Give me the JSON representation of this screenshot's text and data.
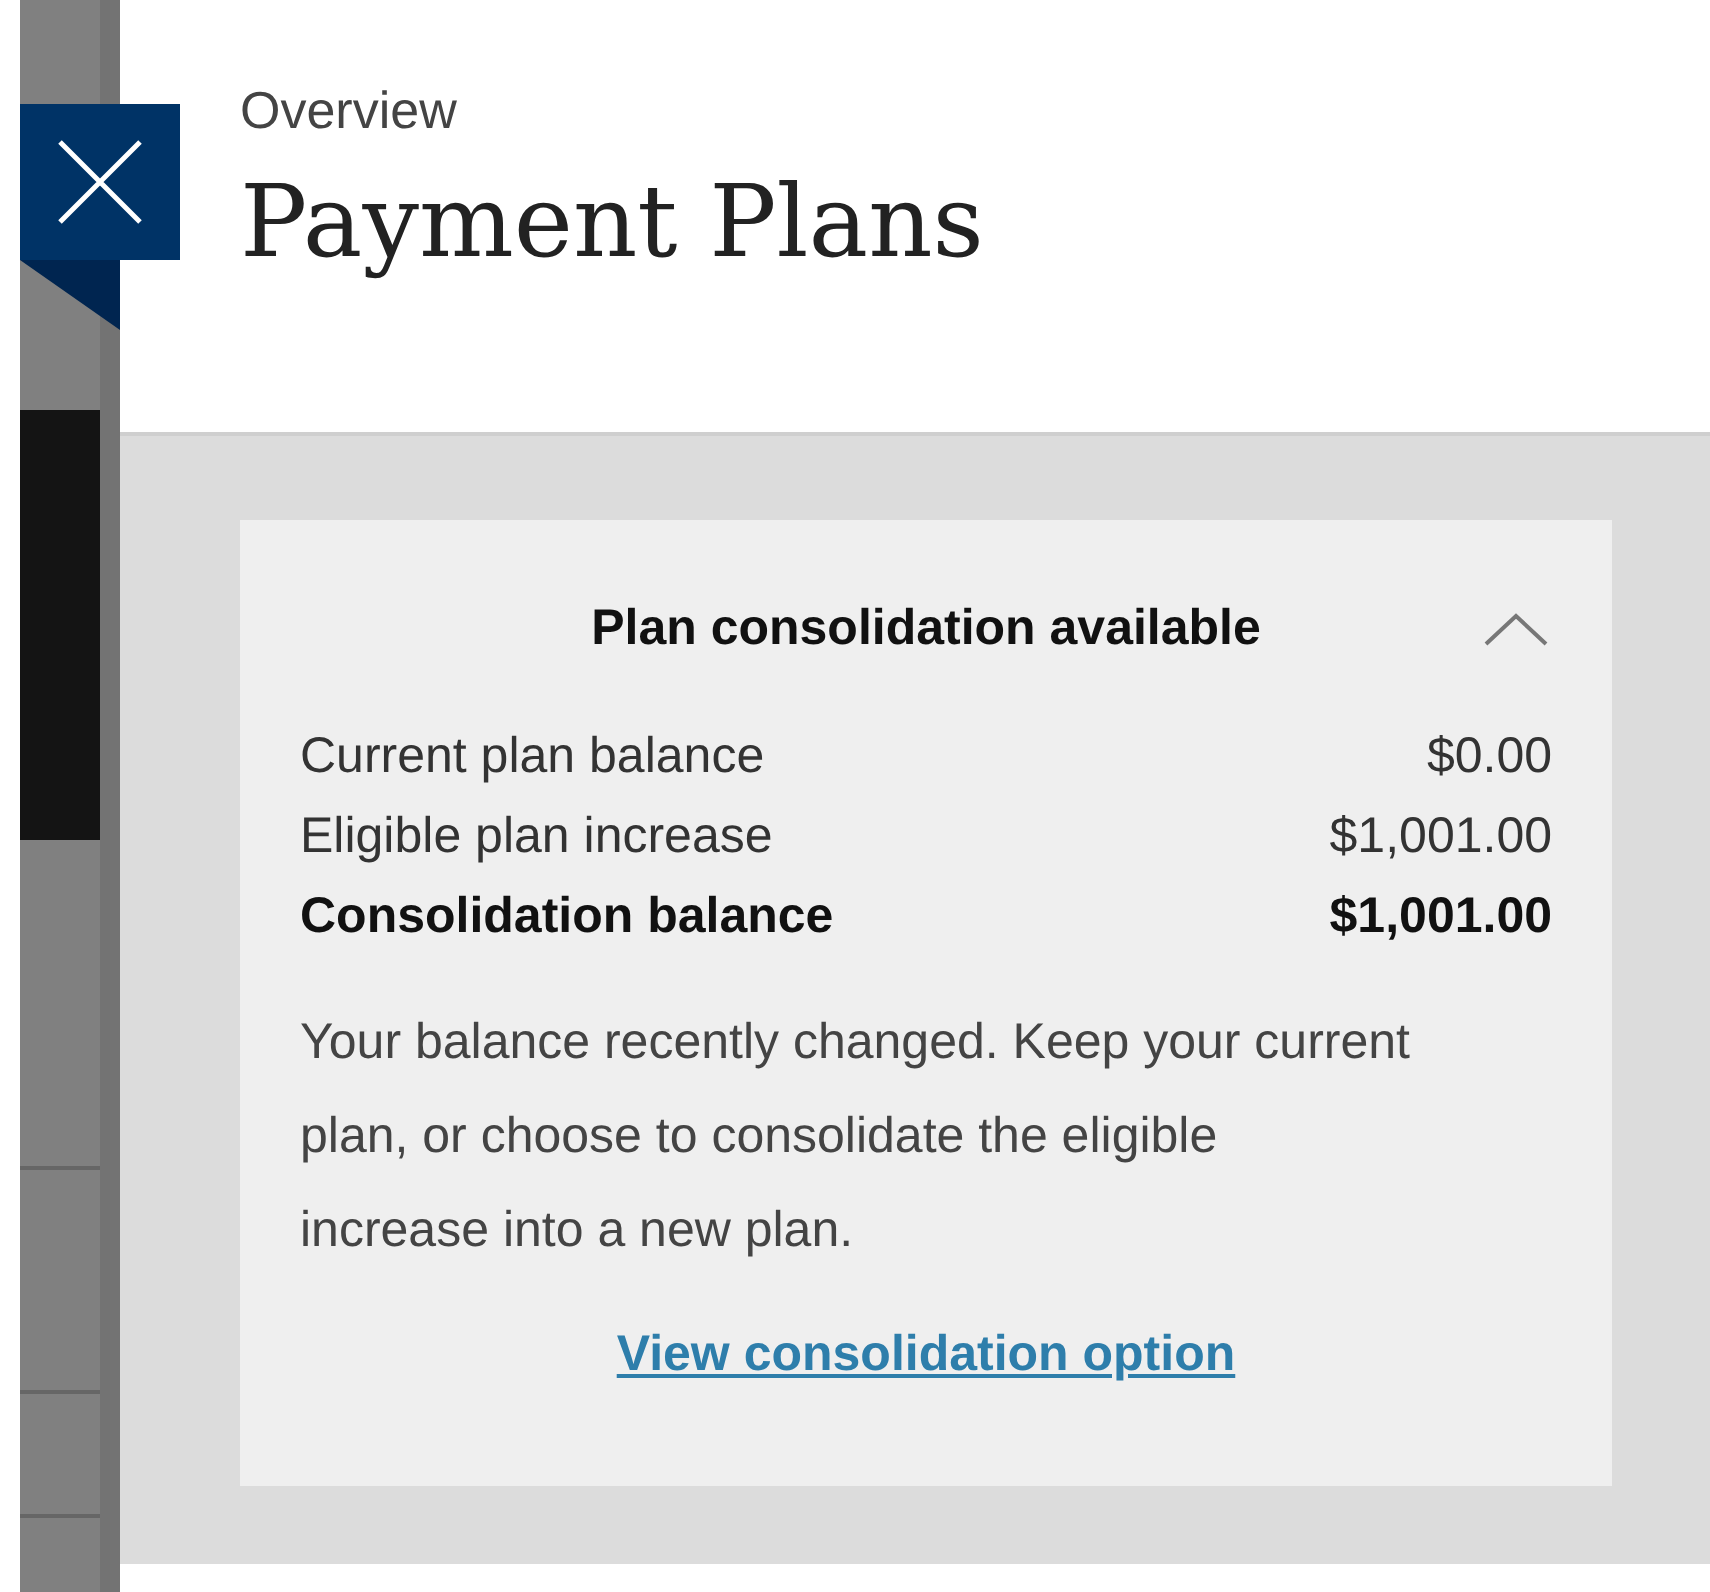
{
  "header": {
    "eyebrow": "Overview",
    "title": "Payment Plans"
  },
  "notice": {
    "title": "Plan consolidation available",
    "expanded": true,
    "rows": [
      {
        "kind": "normal",
        "label": "Current plan balance",
        "value": "$0.00"
      },
      {
        "kind": "normal",
        "label": "Eligible plan increase",
        "value": "$1,001.00"
      },
      {
        "kind": "total",
        "label": "Consolidation balance",
        "value": "$1,001.00"
      }
    ],
    "message": "Your balance recently changed. Keep your current plan, or choose to consolidate the eligible increase into a new plan.",
    "link": "View consolidation option"
  }
}
